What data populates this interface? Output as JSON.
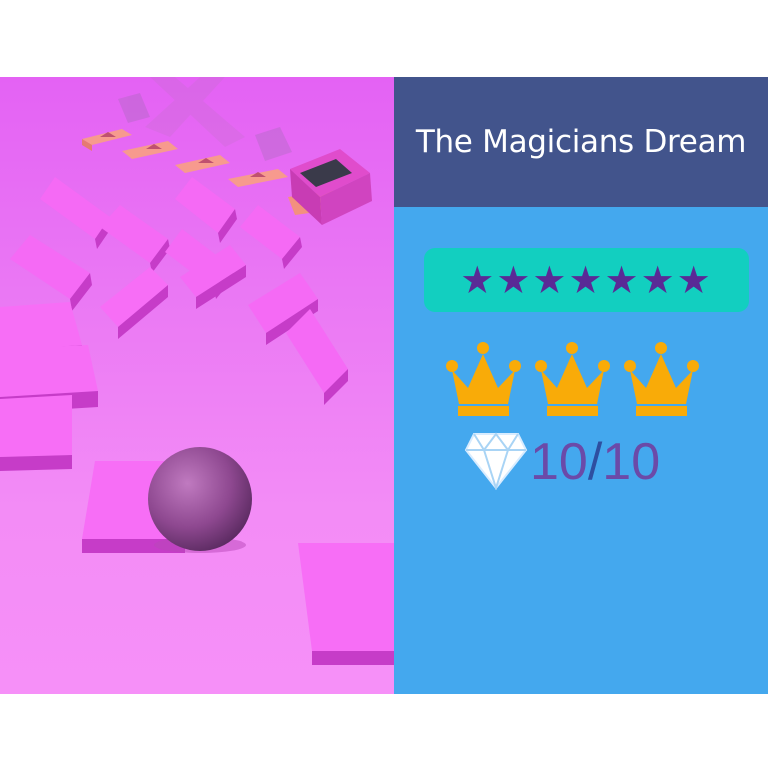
{
  "level": {
    "title": "The Magicians Dream"
  },
  "rating": {
    "stars_text": "★★★★★★★",
    "star_count": 7
  },
  "crowns": {
    "earned": 3,
    "icons": [
      "crown-icon",
      "crown-icon",
      "crown-icon"
    ]
  },
  "gems": {
    "icon": "diamond-icon",
    "collected": "10",
    "separator": "/",
    "total": "10"
  },
  "colors": {
    "title_bar": "#42548c",
    "panel": "#44a8ee",
    "rating_box": "#12cfc0",
    "star": "#5a2a96",
    "crown": "#f9ab08",
    "gem_text": "#6b4aa8",
    "tile": "#f45cf4",
    "ball": "#9a4a9c"
  }
}
